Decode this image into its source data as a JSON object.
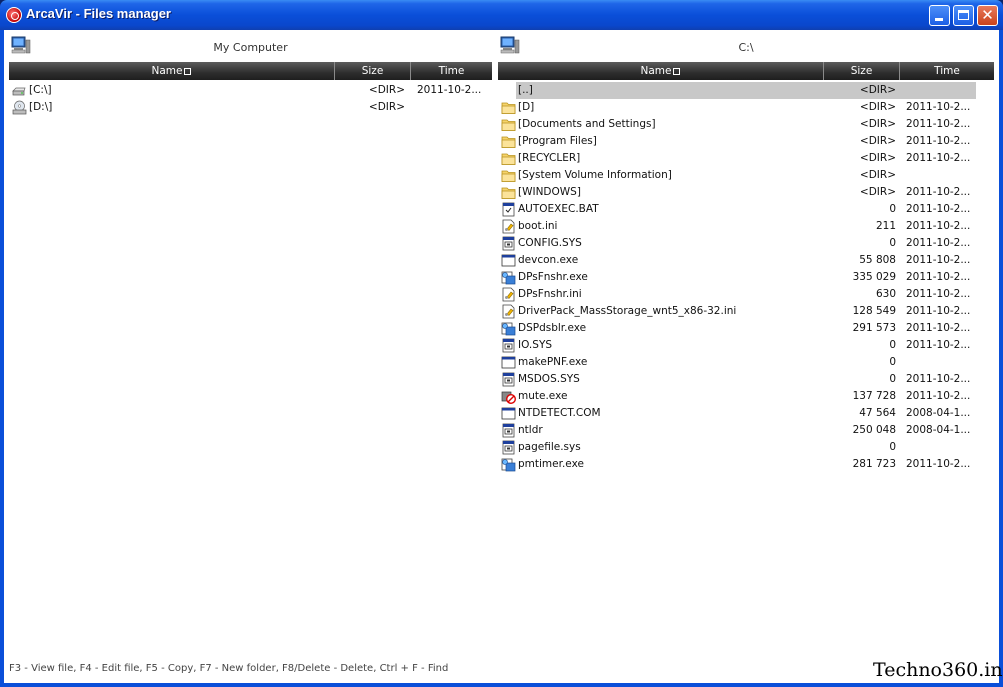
{
  "window": {
    "title": "ArcaVir - Files manager"
  },
  "left_pane": {
    "title": "My Computer",
    "columns": {
      "name": "Name",
      "size": "Size",
      "time": "Time"
    },
    "rows": [
      {
        "icon": "hard-drive-icon",
        "name": "[C:\\]",
        "size": "<DIR>",
        "time": "2011-10-2..."
      },
      {
        "icon": "cd-drive-icon",
        "name": "[D:\\]",
        "size": "<DIR>",
        "time": ""
      }
    ]
  },
  "right_pane": {
    "title": "C:\\",
    "columns": {
      "name": "Name",
      "size": "Size",
      "time": "Time"
    },
    "rows": [
      {
        "icon": "",
        "name": "[..]",
        "size": "<DIR>",
        "time": "",
        "selected": true
      },
      {
        "icon": "folder-icon",
        "name": "[D]",
        "size": "<DIR>",
        "time": "2011-10-2..."
      },
      {
        "icon": "folder-icon",
        "name": "[Documents and Settings]",
        "size": "<DIR>",
        "time": "2011-10-2..."
      },
      {
        "icon": "folder-icon",
        "name": "[Program Files]",
        "size": "<DIR>",
        "time": "2011-10-2..."
      },
      {
        "icon": "folder-icon",
        "name": "[RECYCLER]",
        "size": "<DIR>",
        "time": "2011-10-2..."
      },
      {
        "icon": "folder-icon",
        "name": "[System Volume Information]",
        "size": "<DIR>",
        "time": ""
      },
      {
        "icon": "folder-icon",
        "name": "[WINDOWS]",
        "size": "<DIR>",
        "time": "2011-10-2..."
      },
      {
        "icon": "batch-file-icon",
        "name": "AUTOEXEC.BAT",
        "size": "0",
        "time": "2011-10-2..."
      },
      {
        "icon": "ini-file-icon",
        "name": "boot.ini",
        "size": "211",
        "time": "2011-10-2..."
      },
      {
        "icon": "system-file-icon",
        "name": "CONFIG.SYS",
        "size": "0",
        "time": "2011-10-2..."
      },
      {
        "icon": "exe-file-icon",
        "name": "devcon.exe",
        "size": "55 808",
        "time": "2011-10-2..."
      },
      {
        "icon": "setup-exe-icon",
        "name": "DPsFnshr.exe",
        "size": "335 029",
        "time": "2011-10-2..."
      },
      {
        "icon": "ini-file-icon",
        "name": "DPsFnshr.ini",
        "size": "630",
        "time": "2011-10-2..."
      },
      {
        "icon": "ini-file-icon",
        "name": "DriverPack_MassStorage_wnt5_x86-32.ini",
        "size": "128 549",
        "time": "2011-10-2..."
      },
      {
        "icon": "setup-exe-icon",
        "name": "DSPdsblr.exe",
        "size": "291 573",
        "time": "2011-10-2..."
      },
      {
        "icon": "system-file-icon",
        "name": "IO.SYS",
        "size": "0",
        "time": "2011-10-2..."
      },
      {
        "icon": "exe-file-icon",
        "name": "makePNF.exe",
        "size": "0",
        "time": ""
      },
      {
        "icon": "system-file-icon",
        "name": "MSDOS.SYS",
        "size": "0",
        "time": "2011-10-2..."
      },
      {
        "icon": "mute-exe-icon",
        "name": "mute.exe",
        "size": "137 728",
        "time": "2011-10-2..."
      },
      {
        "icon": "exe-file-icon",
        "name": "NTDETECT.COM",
        "size": "47 564",
        "time": "2008-04-1..."
      },
      {
        "icon": "system-file-icon",
        "name": "ntldr",
        "size": "250 048",
        "time": "2008-04-1..."
      },
      {
        "icon": "system-file-icon",
        "name": "pagefile.sys",
        "size": "0",
        "time": ""
      },
      {
        "icon": "setup-exe-icon",
        "name": "pmtimer.exe",
        "size": "281 723",
        "time": "2011-10-2..."
      }
    ]
  },
  "status_bar": {
    "text": "F3 - View file, F4 - Edit file, F5 - Copy, F7 - New folder, F8/Delete - Delete, Ctrl + F - Find"
  },
  "watermark": {
    "text": "Techno360.in"
  }
}
